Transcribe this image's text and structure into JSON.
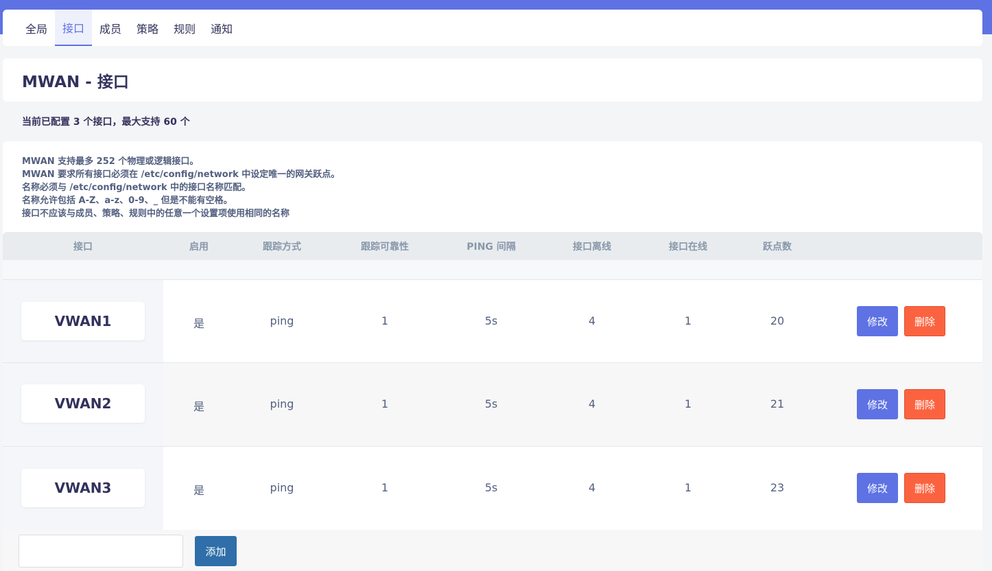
{
  "tabs": [
    {
      "label": "全局",
      "active": false
    },
    {
      "label": "接口",
      "active": true
    },
    {
      "label": "成员",
      "active": false
    },
    {
      "label": "策略",
      "active": false
    },
    {
      "label": "规则",
      "active": false
    },
    {
      "label": "通知",
      "active": false
    }
  ],
  "page": {
    "title": "MWAN - 接口",
    "summary": "当前已配置 3 个接口，最大支持 60 个"
  },
  "notes": [
    "MWAN 支持最多 252 个物理或逻辑接口。",
    "MWAN 要求所有接口必须在 /etc/config/network 中设定唯一的网关跃点。",
    "名称必须与 /etc/config/network 中的接口名称匹配。",
    "名称允许包括 A-Z、a-z、0-9、_ 但是不能有空格。",
    "接口不应该与成员、策略、规则中的任意一个设置项使用相同的名称"
  ],
  "table": {
    "headers": [
      "接口",
      "启用",
      "跟踪方式",
      "跟踪可靠性",
      "PING 间隔",
      "接口离线",
      "接口在线",
      "跃点数"
    ],
    "rows": [
      {
        "name": "VWAN1",
        "enabled": "是",
        "track": "ping",
        "reliability": "1",
        "interval": "5s",
        "down": "4",
        "up": "1",
        "metric": "20"
      },
      {
        "name": "VWAN2",
        "enabled": "是",
        "track": "ping",
        "reliability": "1",
        "interval": "5s",
        "down": "4",
        "up": "1",
        "metric": "21"
      },
      {
        "name": "VWAN3",
        "enabled": "是",
        "track": "ping",
        "reliability": "1",
        "interval": "5s",
        "down": "4",
        "up": "1",
        "metric": "23"
      }
    ],
    "edit_label": "修改",
    "delete_label": "删除"
  },
  "footer": {
    "input_value": "",
    "add_label": "添加"
  },
  "colors": {
    "primary": "#5e72e4",
    "danger": "#fb6340",
    "add_button": "#2f6ea8"
  }
}
